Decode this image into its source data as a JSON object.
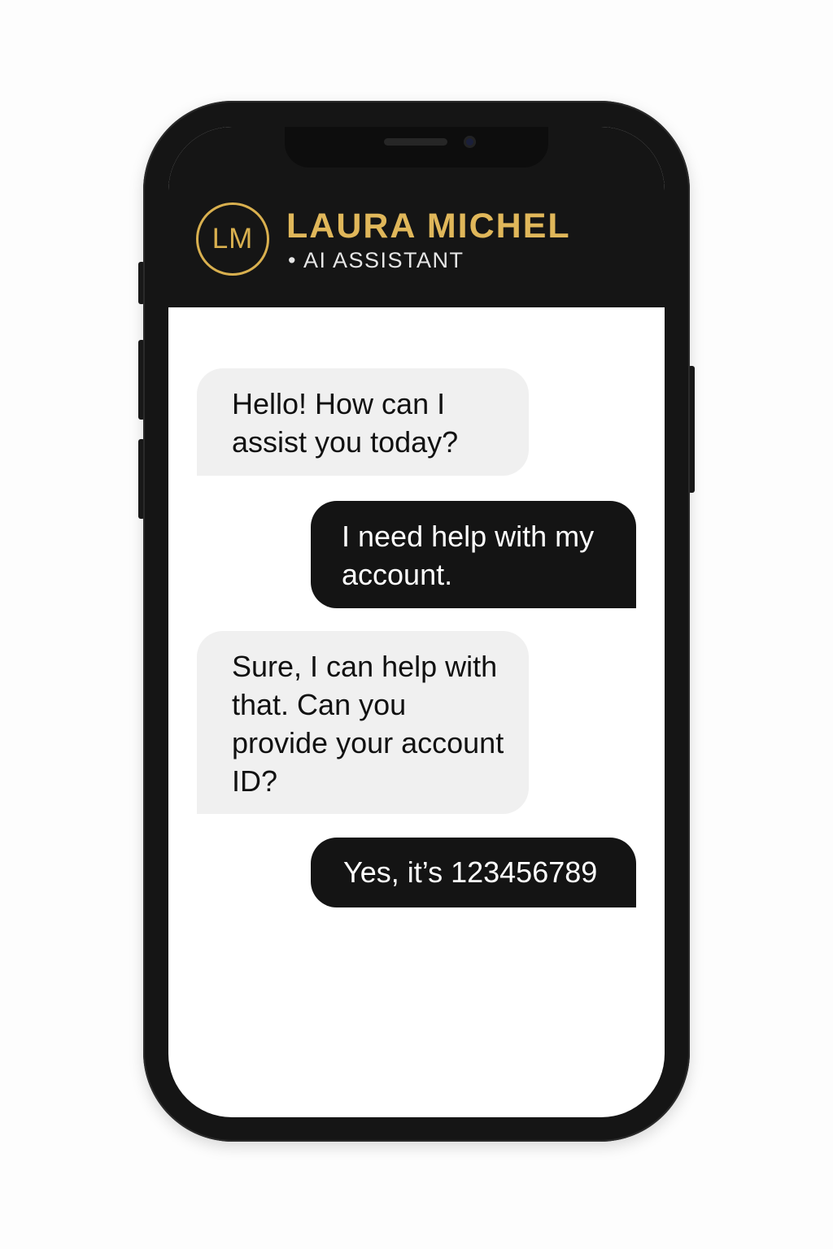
{
  "contact": {
    "initials": "LM",
    "name": "LAURA MICHEL",
    "role": "AI ASSISTANT",
    "accent_color": "#e0b75a"
  },
  "messages": [
    {
      "sender": "assistant",
      "text": "Hello! How can I assist you today?"
    },
    {
      "sender": "user",
      "text": "I need help with my account."
    },
    {
      "sender": "assistant",
      "text": "Sure, I can help with that. Can you provide your account ID?"
    },
    {
      "sender": "user",
      "text": "Yes, it’s 123456789"
    }
  ],
  "colors": {
    "header_bg": "#151515",
    "incoming_bubble": "#f0f0f0",
    "outgoing_bubble": "#141414"
  }
}
